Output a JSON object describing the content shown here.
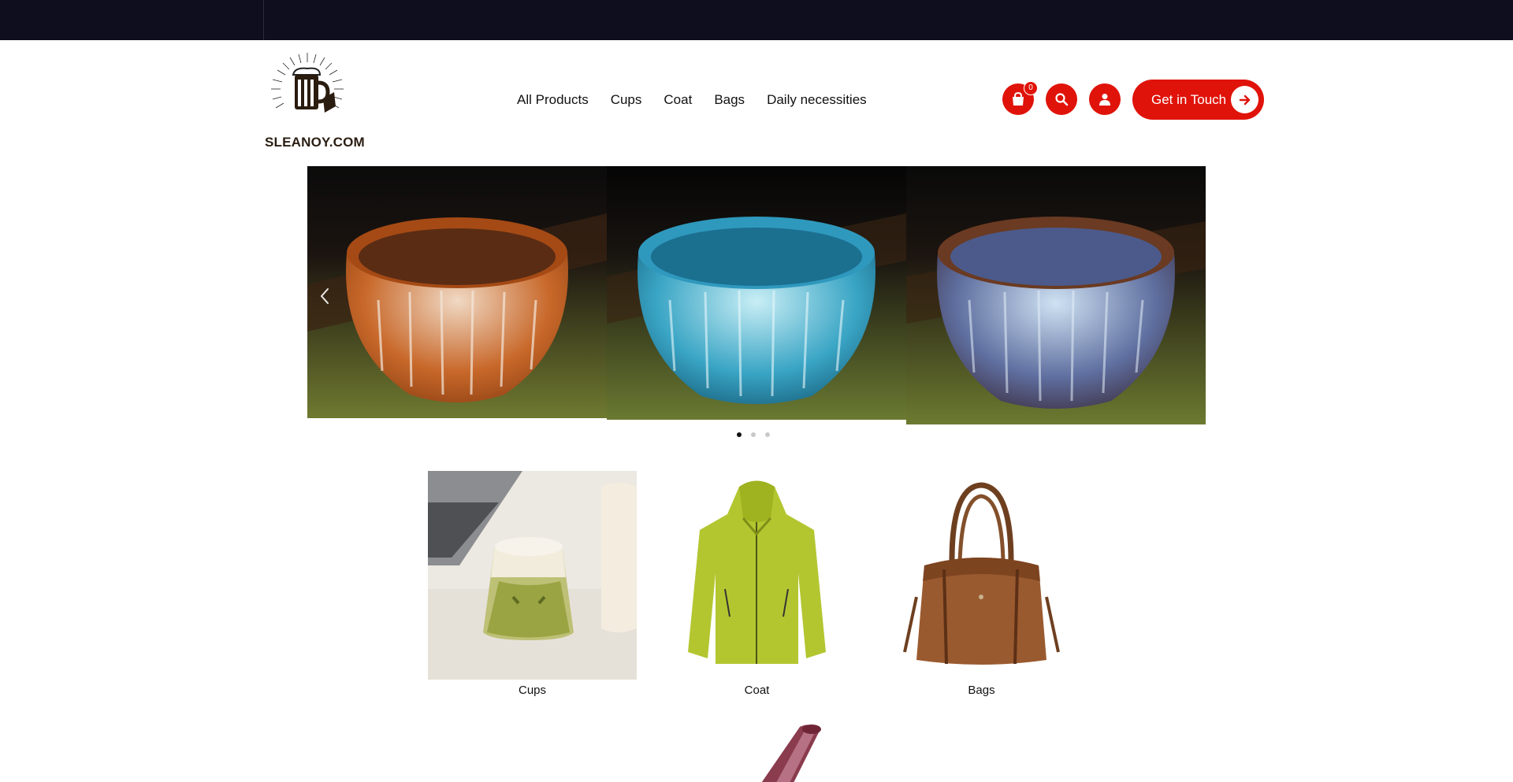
{
  "brand": {
    "name": "SLEANOY.COM",
    "logo_icon": "beer-mug-logo"
  },
  "nav": {
    "items": [
      {
        "label": "All Products"
      },
      {
        "label": "Cups"
      },
      {
        "label": "Coat"
      },
      {
        "label": "Bags"
      },
      {
        "label": "Daily necessities"
      }
    ]
  },
  "actions": {
    "cart_icon": "shopping-bag-icon",
    "cart_count": "0",
    "search_icon": "search-icon",
    "user_icon": "user-icon",
    "cta_label": "Get in Touch",
    "cta_icon": "arrow-right-icon"
  },
  "colors": {
    "topbar": "#0e0e1f",
    "accent": "#e0130a"
  },
  "carousel": {
    "slides": [
      {
        "subject": "orange-glazed-tea-bowl"
      },
      {
        "subject": "blue-glazed-tea-bowl"
      },
      {
        "subject": "purple-blue-glazed-tea-bowl"
      }
    ],
    "prev_icon": "chevron-left-icon",
    "next_icon": "chevron-right-icon",
    "active_dot": 0,
    "dot_count": 3
  },
  "categories": [
    {
      "label": "Cups"
    },
    {
      "label": "Coat"
    },
    {
      "label": "Bags"
    }
  ]
}
